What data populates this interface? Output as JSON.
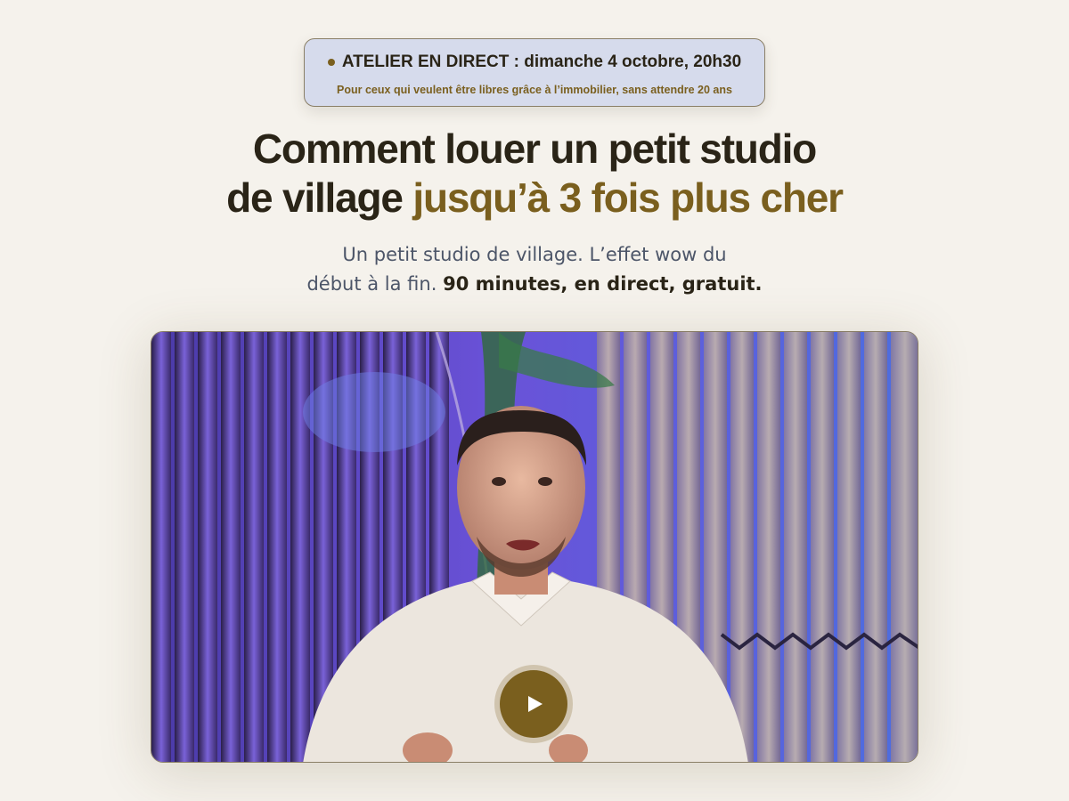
{
  "badge": {
    "title": "ATELIER EN DIRECT : dimanche 4 octobre, 20h30",
    "subtitle": "Pour ceux qui veulent être libres grâce à l’immobilier, sans attendre 20 ans"
  },
  "headline": {
    "line1": "Comment louer un petit studio",
    "line2_start": "de village",
    "line2_accent": "jusqu’à 3 fois plus cher"
  },
  "subheadline": {
    "part1": "Un petit studio de village. L’effet wow du",
    "part2": "début à la fin.",
    "bold": "90 minutes, en direct, gratuit."
  },
  "video": {
    "play_icon": "play-icon"
  },
  "colors": {
    "background": "#f5f2ec",
    "accent": "#7a5f1e",
    "badge_bg": "#d6dbec",
    "text": "#2a2417",
    "muted": "#4c5568"
  }
}
